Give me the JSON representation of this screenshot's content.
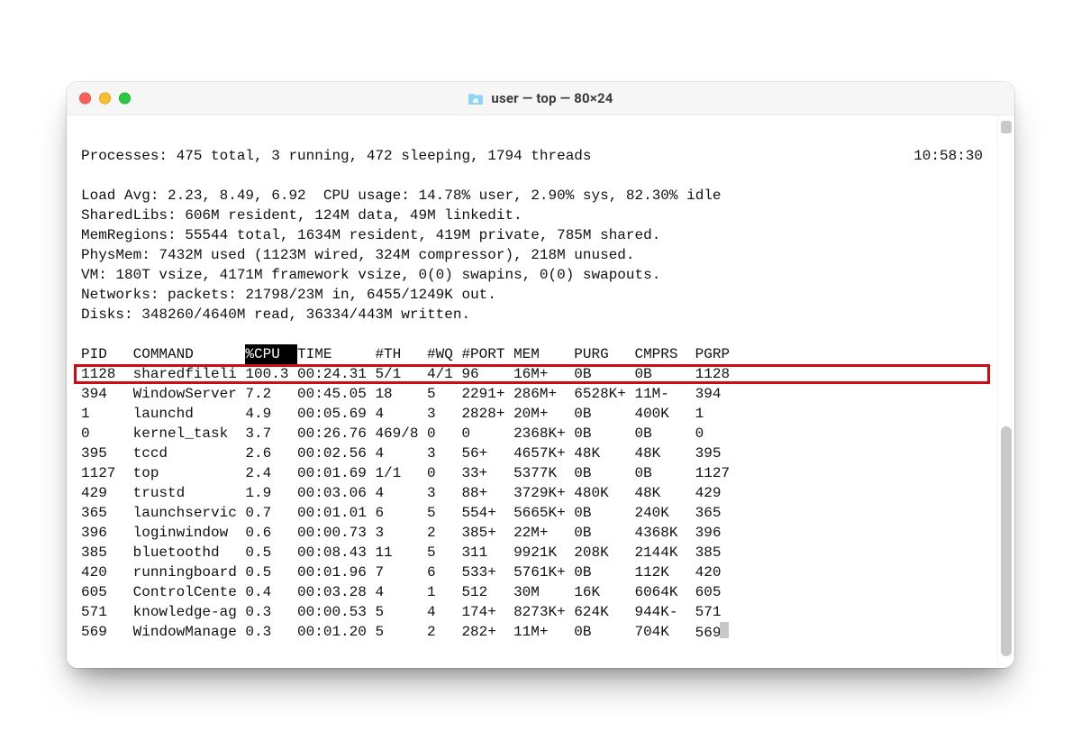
{
  "window": {
    "title": "user — top — 80×24",
    "icon": "folder-home-icon"
  },
  "header": {
    "processes": "Processes: 475 total, 3 running, 472 sleeping, 1794 threads",
    "timestamp": "10:58:30",
    "load_cpu": "Load Avg: 2.23, 8.49, 6.92  CPU usage: 14.78% user, 2.90% sys, 82.30% idle",
    "sharedlibs": "SharedLibs: 606M resident, 124M data, 49M linkedit.",
    "memregions": "MemRegions: 55544 total, 1634M resident, 419M private, 785M shared.",
    "physmem": "PhysMem: 7432M used (1123M wired, 324M compressor), 218M unused.",
    "vm": "VM: 180T vsize, 4171M framework vsize, 0(0) swapins, 0(0) swapouts.",
    "networks": "Networks: packets: 21798/23M in, 6455/1249K out.",
    "disks": "Disks: 348260/4640M read, 36334/443M written."
  },
  "table": {
    "columns": {
      "pid": "PID",
      "cmd": "COMMAND",
      "cpu": "%CPU",
      "time": "TIME",
      "th": "#TH",
      "wq": "#WQ",
      "port": "#PORT",
      "mem": "MEM",
      "purg": "PURG",
      "cmprs": "CMPRS",
      "pgrp": "PGRP"
    },
    "highlight_row_index": 0,
    "rows": [
      {
        "pid": "1128",
        "cmd": "sharedfileli",
        "cpu": "100.3",
        "time": "00:24.31",
        "th": "5/1",
        "wq": "4/1",
        "port": "96",
        "mem": "16M+",
        "purg": "0B",
        "cmprs": "0B",
        "pgrp": "1128"
      },
      {
        "pid": "394",
        "cmd": "WindowServer",
        "cpu": "7.2",
        "time": "00:45.05",
        "th": "18",
        "wq": "5",
        "port": "2291+",
        "mem": "286M+",
        "purg": "6528K+",
        "cmprs": "11M-",
        "pgrp": "394"
      },
      {
        "pid": "1",
        "cmd": "launchd",
        "cpu": "4.9",
        "time": "00:05.69",
        "th": "4",
        "wq": "3",
        "port": "2828+",
        "mem": "20M+",
        "purg": "0B",
        "cmprs": "400K",
        "pgrp": "1"
      },
      {
        "pid": "0",
        "cmd": "kernel_task",
        "cpu": "3.7",
        "time": "00:26.76",
        "th": "469/8",
        "wq": "0",
        "port": "0",
        "mem": "2368K+",
        "purg": "0B",
        "cmprs": "0B",
        "pgrp": "0"
      },
      {
        "pid": "395",
        "cmd": "tccd",
        "cpu": "2.6",
        "time": "00:02.56",
        "th": "4",
        "wq": "3",
        "port": "56+",
        "mem": "4657K+",
        "purg": "48K",
        "cmprs": "48K",
        "pgrp": "395"
      },
      {
        "pid": "1127",
        "cmd": "top",
        "cpu": "2.4",
        "time": "00:01.69",
        "th": "1/1",
        "wq": "0",
        "port": "33+",
        "mem": "5377K",
        "purg": "0B",
        "cmprs": "0B",
        "pgrp": "1127"
      },
      {
        "pid": "429",
        "cmd": "trustd",
        "cpu": "1.9",
        "time": "00:03.06",
        "th": "4",
        "wq": "3",
        "port": "88+",
        "mem": "3729K+",
        "purg": "480K",
        "cmprs": "48K",
        "pgrp": "429"
      },
      {
        "pid": "365",
        "cmd": "launchservic",
        "cpu": "0.7",
        "time": "00:01.01",
        "th": "6",
        "wq": "5",
        "port": "554+",
        "mem": "5665K+",
        "purg": "0B",
        "cmprs": "240K",
        "pgrp": "365"
      },
      {
        "pid": "396",
        "cmd": "loginwindow",
        "cpu": "0.6",
        "time": "00:00.73",
        "th": "3",
        "wq": "2",
        "port": "385+",
        "mem": "22M+",
        "purg": "0B",
        "cmprs": "4368K",
        "pgrp": "396"
      },
      {
        "pid": "385",
        "cmd": "bluetoothd",
        "cpu": "0.5",
        "time": "00:08.43",
        "th": "11",
        "wq": "5",
        "port": "311",
        "mem": "9921K",
        "purg": "208K",
        "cmprs": "2144K",
        "pgrp": "385"
      },
      {
        "pid": "420",
        "cmd": "runningboard",
        "cpu": "0.5",
        "time": "00:01.96",
        "th": "7",
        "wq": "6",
        "port": "533+",
        "mem": "5761K+",
        "purg": "0B",
        "cmprs": "112K",
        "pgrp": "420"
      },
      {
        "pid": "605",
        "cmd": "ControlCente",
        "cpu": "0.4",
        "time": "00:03.28",
        "th": "4",
        "wq": "1",
        "port": "512",
        "mem": "30M",
        "purg": "16K",
        "cmprs": "6064K",
        "pgrp": "605"
      },
      {
        "pid": "571",
        "cmd": "knowledge-ag",
        "cpu": "0.3",
        "time": "00:00.53",
        "th": "5",
        "wq": "4",
        "port": "174+",
        "mem": "8273K+",
        "purg": "624K",
        "cmprs": "944K-",
        "pgrp": "571"
      },
      {
        "pid": "569",
        "cmd": "WindowManage",
        "cpu": "0.3",
        "time": "00:01.20",
        "th": "5",
        "wq": "2",
        "port": "282+",
        "mem": "11M+",
        "purg": "0B",
        "cmprs": "704K",
        "pgrp": "569"
      }
    ]
  }
}
